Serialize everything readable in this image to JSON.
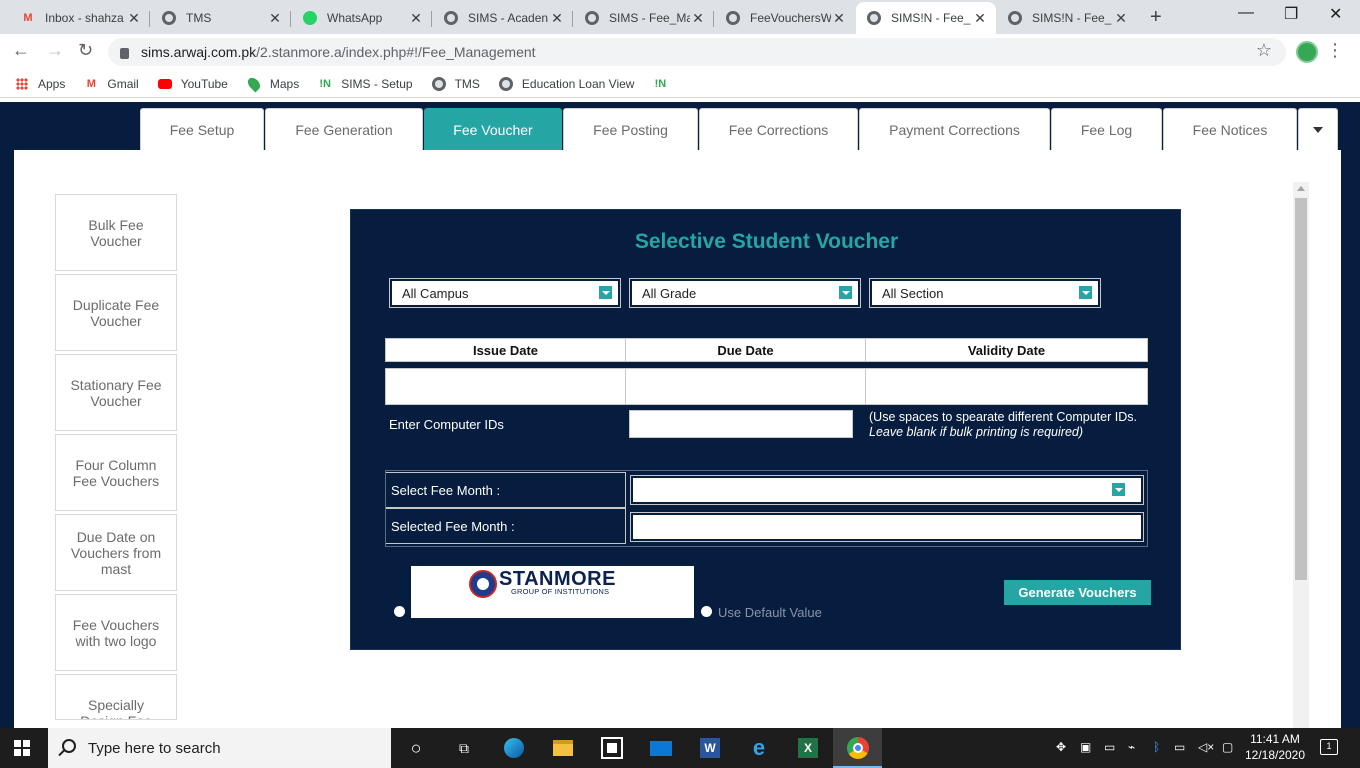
{
  "browser": {
    "tabs": [
      {
        "title": "Inbox - shahza",
        "icon": "gmail-icon"
      },
      {
        "title": "TMS",
        "icon": "globe-icon"
      },
      {
        "title": "WhatsApp",
        "icon": "whatsapp-icon"
      },
      {
        "title": "SIMS - Acaden",
        "icon": "globe-icon"
      },
      {
        "title": "SIMS - Fee_Ma",
        "icon": "globe-icon"
      },
      {
        "title": "FeeVouchersW",
        "icon": "globe-icon"
      },
      {
        "title": "SIMS!N - Fee_",
        "icon": "globe-icon",
        "active": true
      },
      {
        "title": "SIMS!N - Fee_",
        "icon": "globe-icon"
      }
    ],
    "url_host": "sims.arwaj.com.pk",
    "url_path": "/2.stanmore.a/index.php#!/Fee_Management",
    "bookmarks": [
      {
        "label": "Apps",
        "icon": "apps-grid-icon"
      },
      {
        "label": "Gmail",
        "icon": "gmail-icon"
      },
      {
        "label": "YouTube",
        "icon": "youtube-icon"
      },
      {
        "label": "Maps",
        "icon": "maps-icon"
      },
      {
        "label": "SIMS - Setup",
        "icon": "sims-in-icon"
      },
      {
        "label": "TMS",
        "icon": "globe-icon"
      },
      {
        "label": "Education Loan View",
        "icon": "globe-icon"
      }
    ]
  },
  "fee_tabs": [
    {
      "label": "Fee Setup"
    },
    {
      "label": "Fee Generation"
    },
    {
      "label": "Fee Voucher",
      "active": true
    },
    {
      "label": "Fee Posting"
    },
    {
      "label": "Fee Corrections"
    },
    {
      "label": "Payment Corrections"
    },
    {
      "label": "Fee Log"
    },
    {
      "label": "Fee Notices"
    }
  ],
  "sidebar": {
    "items": [
      {
        "label": "Bulk Fee Voucher"
      },
      {
        "label": "Duplicate Fee Voucher"
      },
      {
        "label": "Stationary Fee Voucher"
      },
      {
        "label": "Four Column Fee Vouchers"
      },
      {
        "label": "Due Date on Vouchers from mast"
      },
      {
        "label": "Fee Vouchers with two logo"
      },
      {
        "label": "Specially Design Fee"
      }
    ]
  },
  "panel": {
    "title": "Selective Student Voucher",
    "campus_select": "All Campus",
    "grade_select": "All Grade",
    "section_select": "All Section",
    "date_headers": {
      "issue": "Issue Date",
      "due": "Due Date",
      "validity": "Validity Date"
    },
    "computer_ids_label": "Enter Computer IDs",
    "hint_line1": "(Use spaces to spearate different Computer IDs.",
    "hint_line2": "Leave blank if bulk printing is required)",
    "select_month_label": "Select Fee Month :",
    "selected_month_label": "Selected Fee Month :",
    "logo_name": "STANMORE",
    "logo_sub": "GROUP OF INSTITUTIONS",
    "default_value_label": "Use Default Value",
    "generate_button": "Generate Vouchers"
  },
  "taskbar": {
    "search_placeholder": "Type here to search",
    "time": "11:41 AM",
    "date": "12/18/2020",
    "notification_count": "1"
  },
  "colors": {
    "navy": "#071d3f",
    "teal": "#26a5a5"
  }
}
